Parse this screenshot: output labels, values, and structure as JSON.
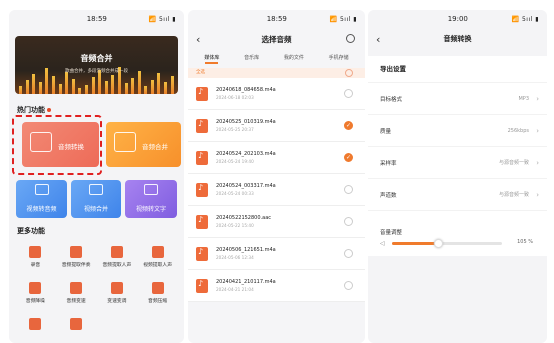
{
  "phone1": {
    "status_time": "18:59",
    "status_icons": "📶 5ııl ▮",
    "banner_title": "音频合并",
    "banner_subtitle": "歌曲合并，多段音频合并成一段",
    "hot_label": "热门功能",
    "card_convert": "音频转换",
    "card_merge": "音频合并",
    "card_video_to_audio": "视频转音频",
    "card_video_merge": "视频合并",
    "card_video_to_text": "视频转文字",
    "more_label": "更多功能",
    "grid": [
      {
        "label": "录音",
        "icon": "mic-icon"
      },
      {
        "label": "音频提取伴奏",
        "icon": "accompaniment-icon"
      },
      {
        "label": "音频提取人声",
        "icon": "vocal-icon"
      },
      {
        "label": "视频提取人声",
        "icon": "video-vocal-icon"
      },
      {
        "label": "音频降噪",
        "icon": "denoise-icon"
      },
      {
        "label": "音频变速",
        "icon": "speed-icon"
      },
      {
        "label": "变速变调",
        "icon": "pitch-icon"
      },
      {
        "label": "音频压缩",
        "icon": "compress-icon"
      },
      {
        "label": "",
        "icon": "more-icon-1"
      },
      {
        "label": "",
        "icon": "more-icon-2"
      }
    ]
  },
  "phone2": {
    "status_time": "18:59",
    "title": "选择音频",
    "tabs": [
      "媒体库",
      "音乐库",
      "我的文件",
      "手机存储"
    ],
    "all_label": "全选",
    "files": [
      {
        "name": "20240618_084658.m4a",
        "date": "2024-06-18  02:03",
        "checked": false
      },
      {
        "name": "20240525_010319.m4a",
        "date": "2024-05-25  20:37",
        "checked": true
      },
      {
        "name": "20240524_202103.m4a",
        "date": "2024-05-24  19:40",
        "checked": true
      },
      {
        "name": "20240524_003317.m4a",
        "date": "2024-05-24  00:33",
        "checked": false
      },
      {
        "name": "20240522152800.aac",
        "date": "2024-05-22  15:40",
        "checked": false
      },
      {
        "name": "20240506_121651.m4a",
        "date": "2024-05-06  12:34",
        "checked": false
      },
      {
        "name": "20240421_210117.m4a",
        "date": "2024-04-21  21:04",
        "checked": false
      }
    ]
  },
  "phone3": {
    "status_time": "19:00",
    "title": "音频转换",
    "settings_header": "导出设置",
    "rows": [
      {
        "key": "目标格式",
        "value": "MP3"
      },
      {
        "key": "质量",
        "value": "256kbps"
      },
      {
        "key": "采样率",
        "value": "与源音频一致"
      },
      {
        "key": "声道数",
        "value": "与源音频一致"
      }
    ],
    "volume_label": "音量调整",
    "volume_value": "105 %",
    "volume_fraction": 0.42
  }
}
